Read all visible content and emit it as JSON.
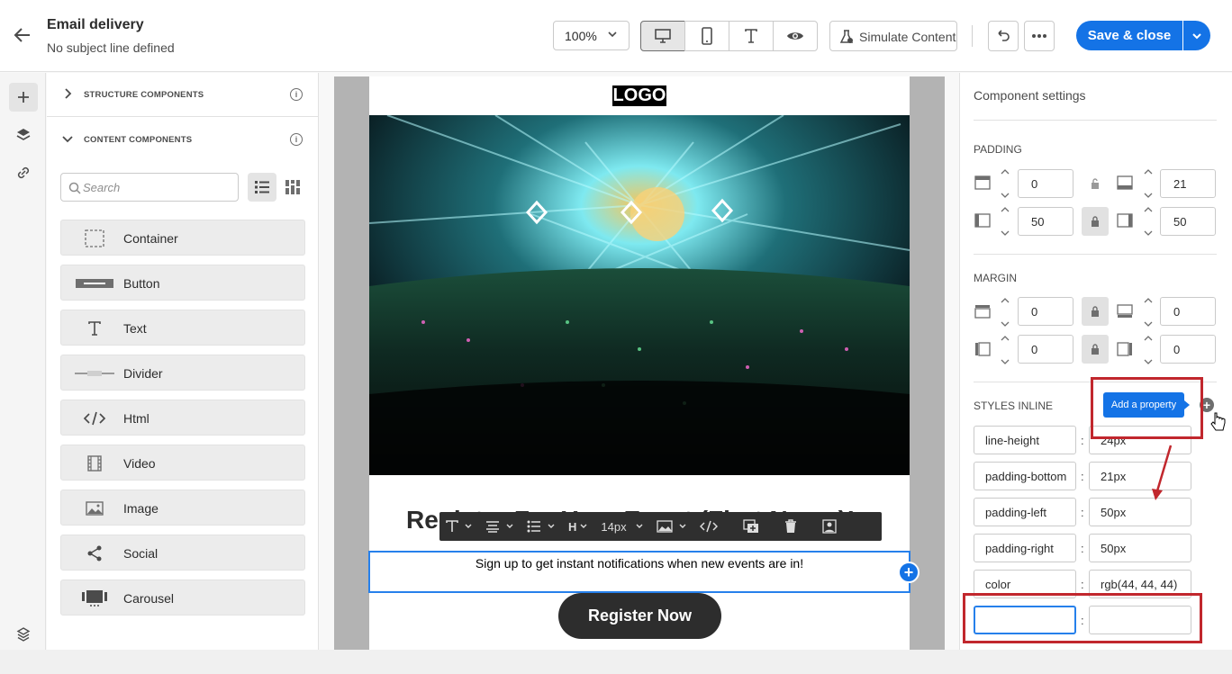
{
  "header": {
    "back_icon": "arrow-left-icon",
    "title": "Email delivery",
    "subtitle": "No subject line defined",
    "zoom_value": "100%",
    "simulate_label": "Simulate Content",
    "save_label": "Save & close"
  },
  "left_panel": {
    "structure_label": "STRUCTURE COMPONENTS",
    "content_label": "CONTENT COMPONENTS",
    "search_placeholder": "Search",
    "components": [
      {
        "label": "Container",
        "icon": "container-icon"
      },
      {
        "label": "Button",
        "icon": "button-icon"
      },
      {
        "label": "Text",
        "icon": "text-icon"
      },
      {
        "label": "Divider",
        "icon": "divider-icon"
      },
      {
        "label": "Html",
        "icon": "code-icon"
      },
      {
        "label": "Video",
        "icon": "video-icon"
      },
      {
        "label": "Image",
        "icon": "image-icon"
      },
      {
        "label": "Social",
        "icon": "share-icon"
      },
      {
        "label": "Carousel",
        "icon": "carousel-icon"
      }
    ]
  },
  "canvas": {
    "logo": "LOGO",
    "headline": "Register For Your Event (First Name)!",
    "toolbar_font_size": "14px",
    "toolbar_heading": "H",
    "subtext": "Sign up to get instant notifications when new events are in!",
    "cta": "Register Now"
  },
  "right_panel": {
    "title": "Component settings",
    "padding_label": "PADDING",
    "padding": {
      "top": "0",
      "bottom": "21",
      "left": "50",
      "right": "50"
    },
    "margin_label": "MARGIN",
    "margin": {
      "top": "0",
      "bottom": "0",
      "left": "0",
      "right": "0"
    },
    "styles_label": "STYLES INLINE",
    "tooltip": "Add a property",
    "styles": [
      {
        "key": "line-height",
        "value": "24px"
      },
      {
        "key": "padding-bottom",
        "value": "21px"
      },
      {
        "key": "padding-left",
        "value": "50px"
      },
      {
        "key": "padding-right",
        "value": "50px"
      },
      {
        "key": "color",
        "value": "rgb(44, 44, 44)"
      }
    ],
    "new_key": "",
    "new_value": ""
  },
  "colors": {
    "accent": "#1473e6",
    "highlight": "#c1272d"
  }
}
